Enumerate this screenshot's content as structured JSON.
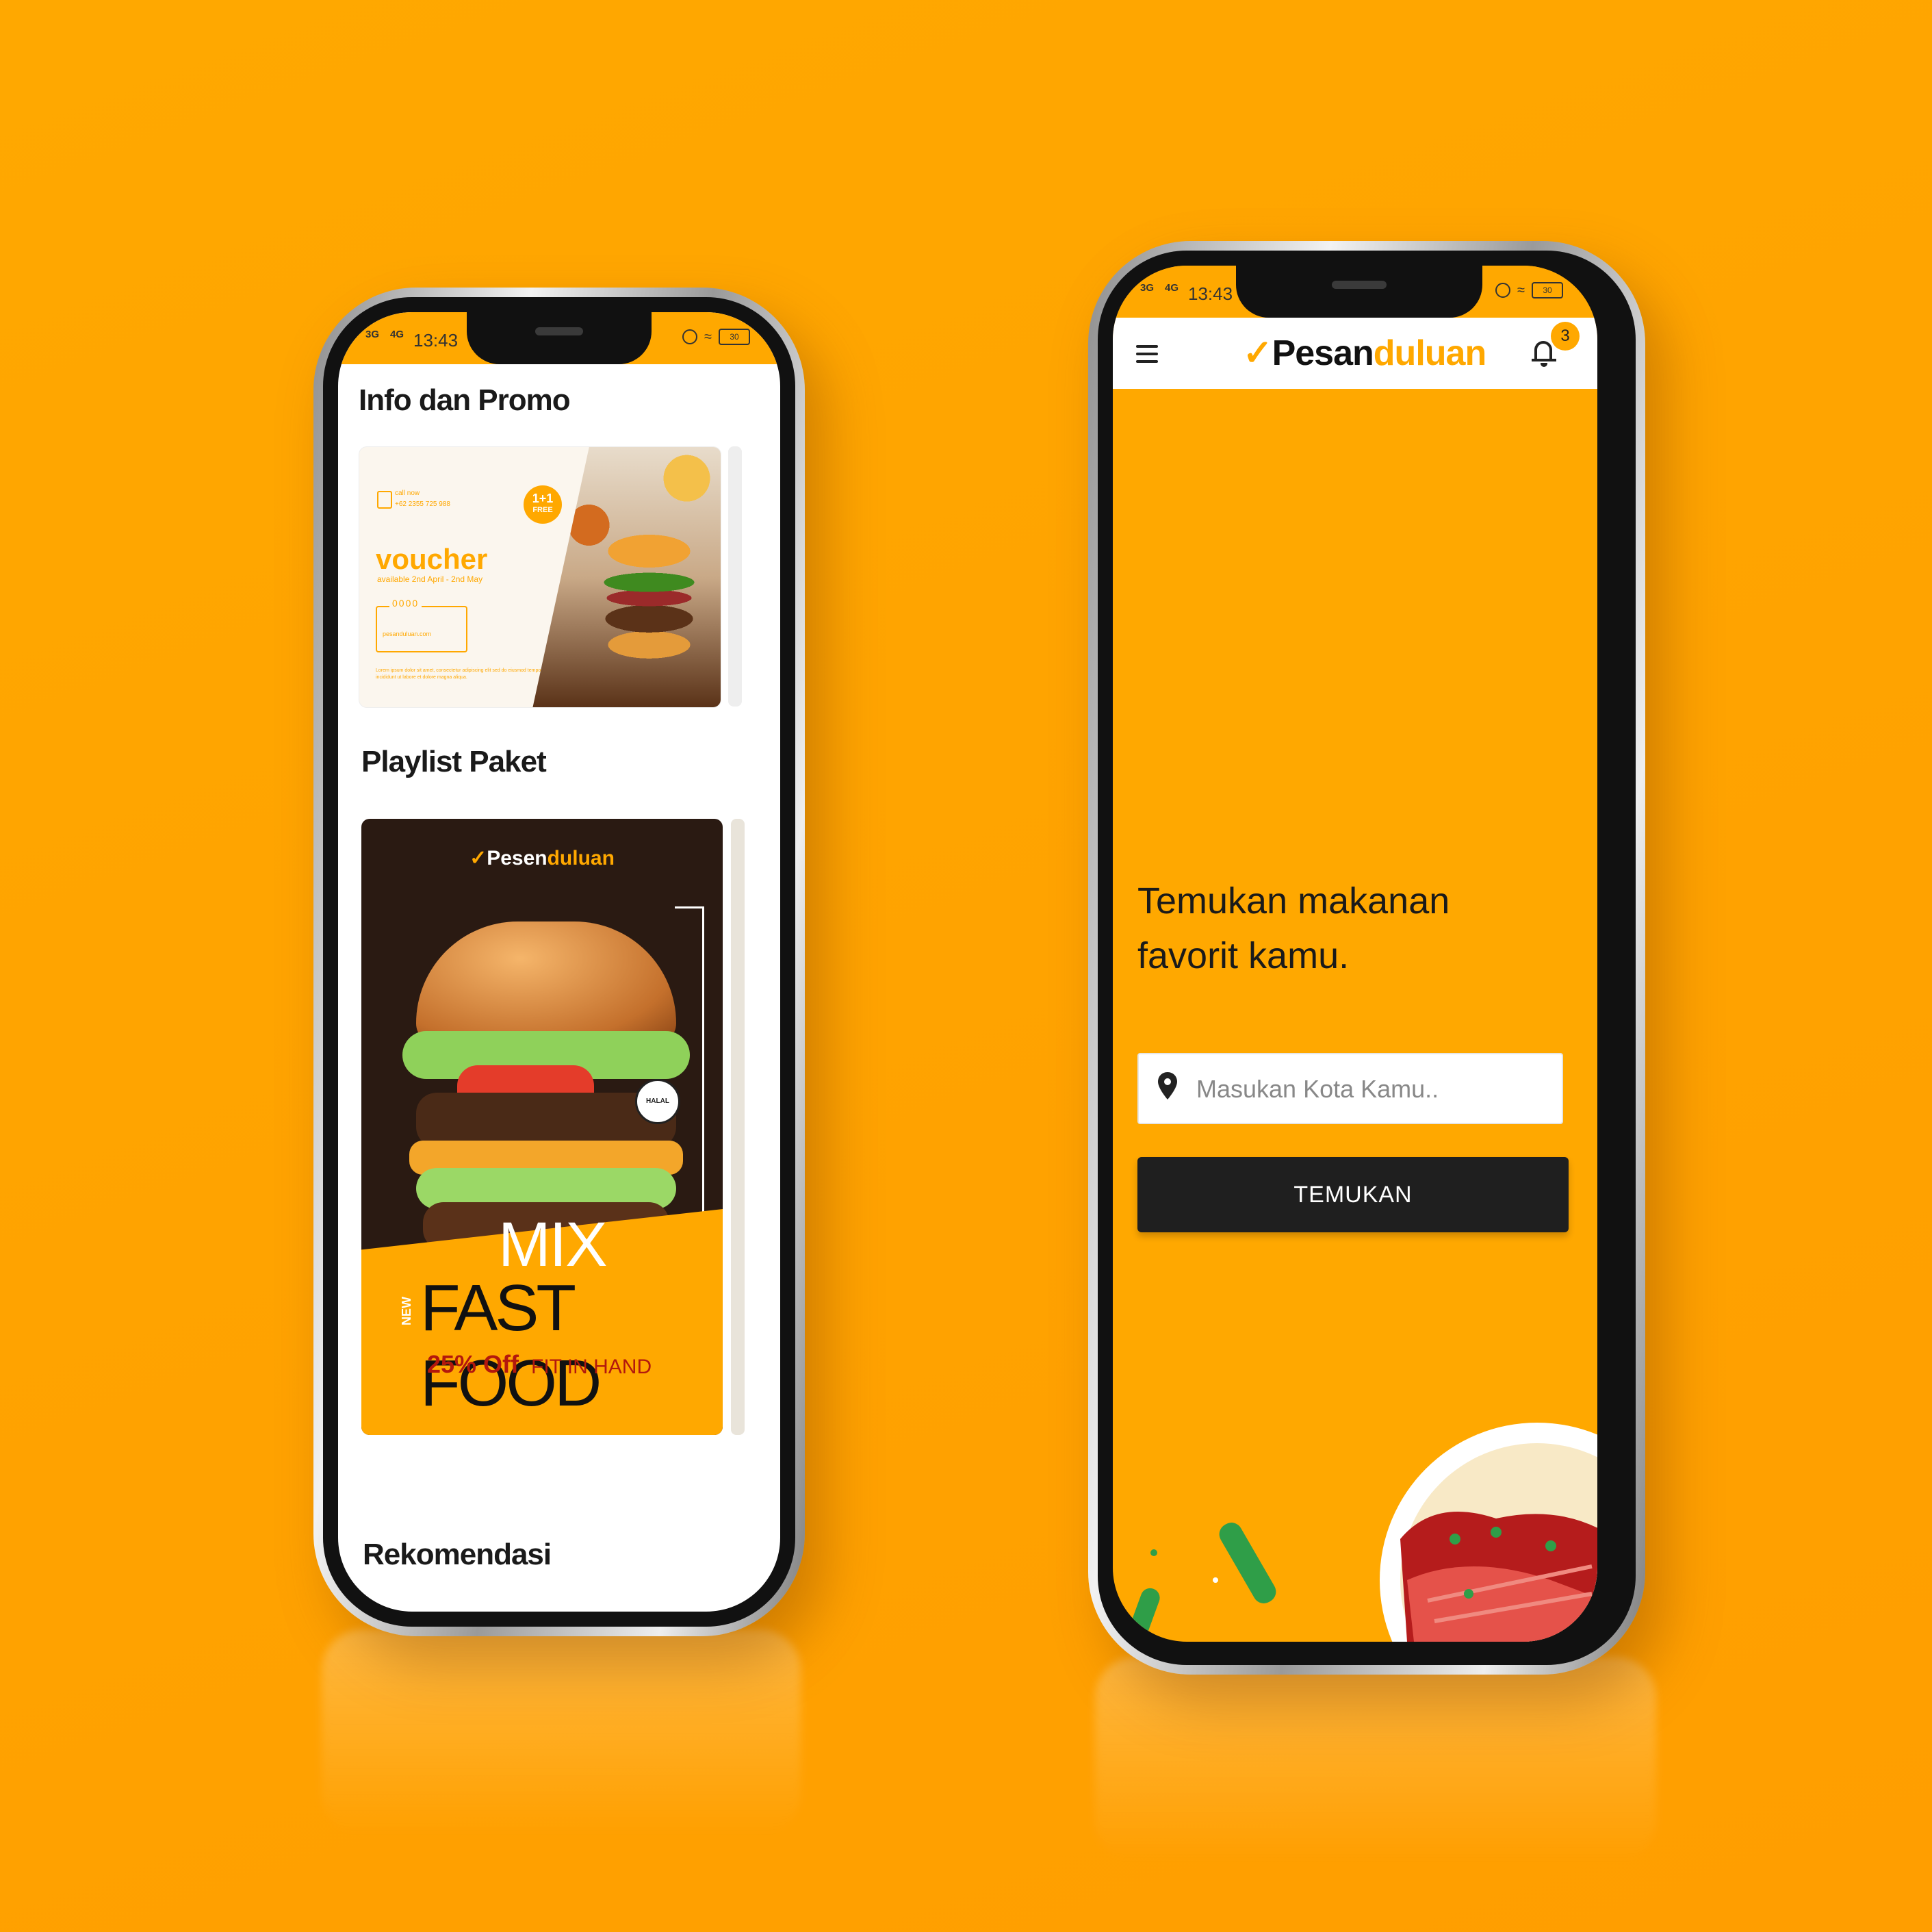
{
  "colors": {
    "brand_orange": "#FFA800",
    "dark": "#1f1f1f",
    "white": "#ffffff"
  },
  "status_bar": {
    "network_left": "3G",
    "network_right": "4G",
    "time": "13:43",
    "battery": "30"
  },
  "left_screen": {
    "section_info_title": "Info dan Promo",
    "voucher": {
      "call_label": "call now",
      "phone": "+62 2355 725 988",
      "word": "voucher",
      "availability": "available 2nd April - 2nd May",
      "badge_big": "1+1",
      "badge_small": "FREE",
      "dots": "0000",
      "site": "pesanduluan.com",
      "lorem": "Lorem ipsum dolor sit amet, consectetur adipiscing elit sed do eiusmod tempor incididunt ut labore et dolore magna aliqua."
    },
    "section_playlist_title": "Playlist Paket",
    "poster": {
      "logo_prefix": "Pesen",
      "logo_suffix": "duluan",
      "badge": "HALAL",
      "mix": "MIX",
      "new": "NEW",
      "fast_food": "FAST FOOD",
      "discount": "25% Off",
      "tagline": "FIT IN HAND"
    },
    "section_recommendation_title": "Rekomendasi"
  },
  "right_screen": {
    "logo_prefix": "Pesan",
    "logo_suffix": "duluan",
    "notification_count": "3",
    "headline_line1": "Temukan makanan",
    "headline_line2": "favorit kamu.",
    "city_placeholder": "Masukan Kota Kamu..",
    "find_button": "TEMUKAN"
  }
}
